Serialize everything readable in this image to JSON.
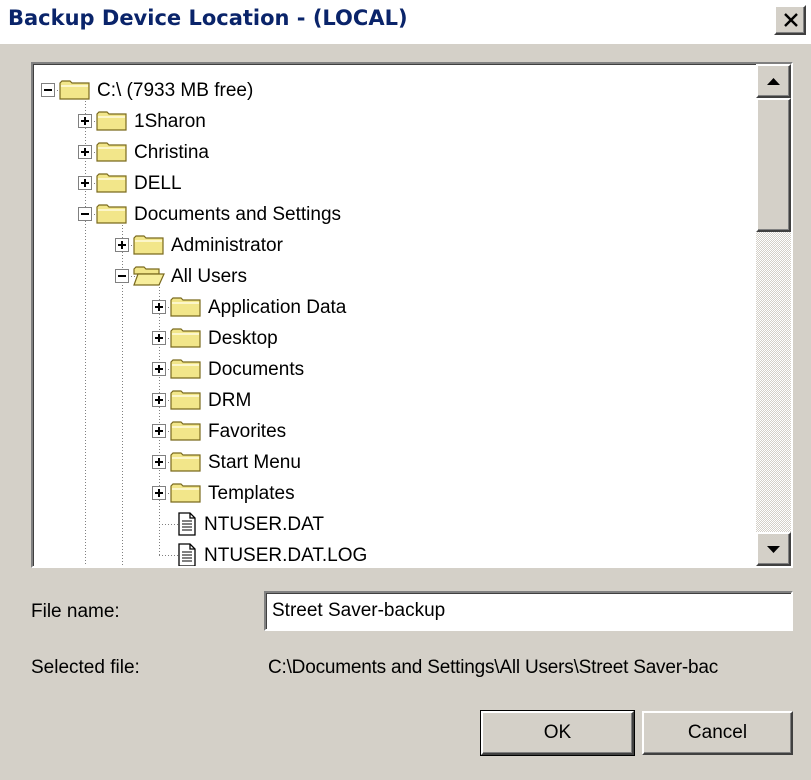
{
  "window": {
    "title": "Backup Device Location - (LOCAL)"
  },
  "tree": {
    "items": [
      {
        "label": "C:\\ (7933 MB free)",
        "level": 0,
        "expander": "minus",
        "icon": "folder"
      },
      {
        "label": "1Sharon",
        "level": 1,
        "expander": "plus",
        "icon": "folder"
      },
      {
        "label": "Christina",
        "level": 1,
        "expander": "plus",
        "icon": "folder"
      },
      {
        "label": "DELL",
        "level": 1,
        "expander": "plus",
        "icon": "folder"
      },
      {
        "label": "Documents and Settings",
        "level": 1,
        "expander": "minus",
        "icon": "folder"
      },
      {
        "label": "Administrator",
        "level": 2,
        "expander": "plus",
        "icon": "folder"
      },
      {
        "label": "All Users",
        "level": 2,
        "expander": "minus",
        "icon": "folder-open"
      },
      {
        "label": "Application Data",
        "level": 3,
        "expander": "plus",
        "icon": "folder"
      },
      {
        "label": "Desktop",
        "level": 3,
        "expander": "plus",
        "icon": "folder"
      },
      {
        "label": "Documents",
        "level": 3,
        "expander": "plus",
        "icon": "folder"
      },
      {
        "label": "DRM",
        "level": 3,
        "expander": "plus",
        "icon": "folder"
      },
      {
        "label": "Favorites",
        "level": 3,
        "expander": "plus",
        "icon": "folder"
      },
      {
        "label": "Start Menu",
        "level": 3,
        "expander": "plus",
        "icon": "folder"
      },
      {
        "label": "Templates",
        "level": 3,
        "expander": "plus",
        "icon": "folder"
      },
      {
        "label": "NTUSER.DAT",
        "level": 3,
        "expander": "none",
        "icon": "file"
      },
      {
        "label": "NTUSER.DAT.LOG",
        "level": 3,
        "expander": "none",
        "icon": "file"
      }
    ]
  },
  "form": {
    "file_name_label": "File name:",
    "file_name_value": "Street Saver-backup",
    "selected_file_label": "Selected file:",
    "selected_file_value": "C:\\Documents and Settings\\All Users\\Street Saver-bac"
  },
  "buttons": {
    "ok": "OK",
    "cancel": "Cancel"
  },
  "colors": {
    "face": "#d4d0c8",
    "folder": "#f2e68a",
    "title_text": "#0a246a"
  }
}
